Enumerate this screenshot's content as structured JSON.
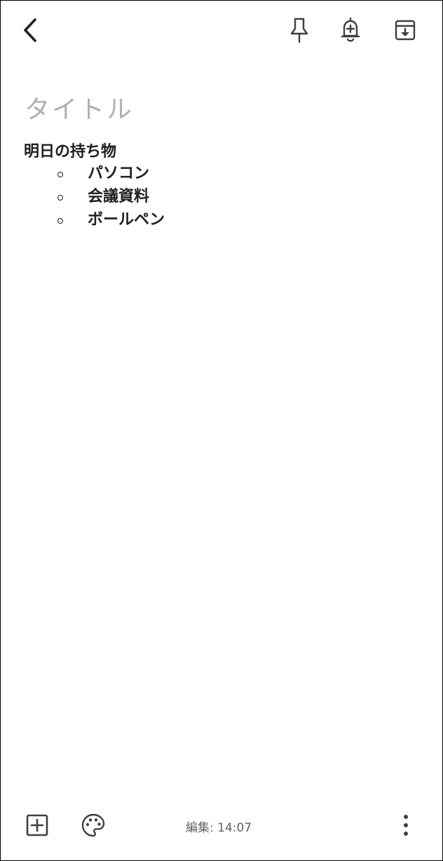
{
  "header": {
    "icons": {
      "back": "chevron-left-icon",
      "pin": "pin-icon",
      "reminder": "bell-plus-icon",
      "archive": "archive-icon"
    }
  },
  "note": {
    "title_placeholder": "タイトル",
    "heading": "明日の持ち物",
    "items": [
      "パソコン",
      "会議資料",
      "ボールペン"
    ]
  },
  "footer": {
    "edited_label": "編集: 14:07",
    "icons": {
      "add": "add-box-icon",
      "palette": "palette-icon",
      "more": "more-vert-icon"
    }
  },
  "colors": {
    "icon": "#3c4043",
    "placeholder": "#b0b0b0",
    "text": "#1f1f1f",
    "meta": "#5f6368"
  }
}
